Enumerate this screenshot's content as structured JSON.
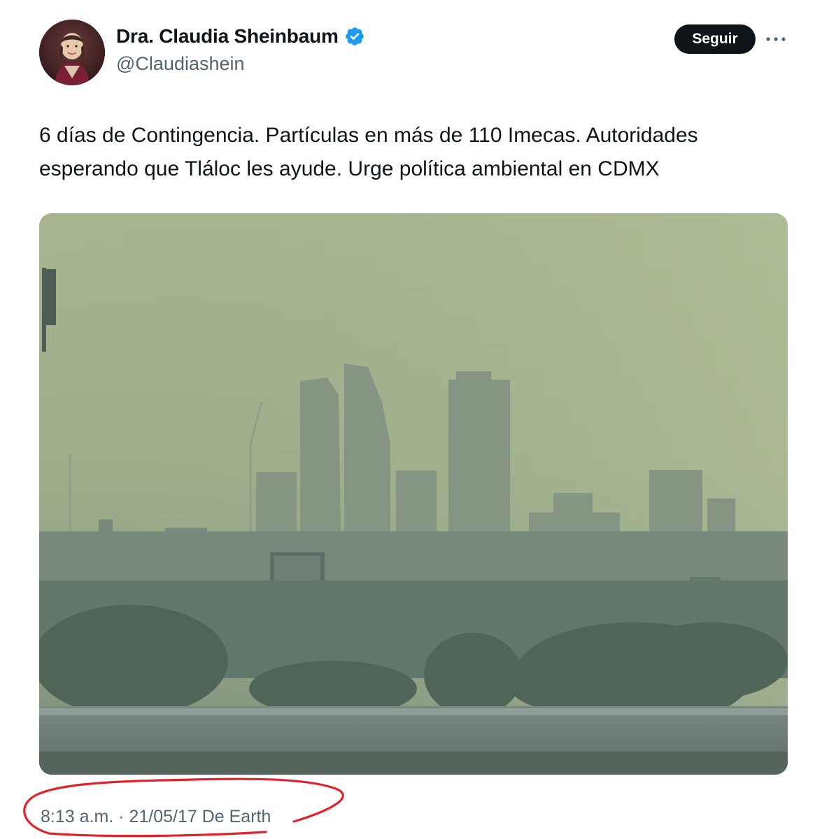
{
  "author": {
    "display_name": "Dra. Claudia Sheinbaum",
    "handle": "@Claudiashein",
    "verified": true,
    "avatar_icon": "profile-photo"
  },
  "actions": {
    "follow_label": "Seguir",
    "more_icon": "more-dots-icon"
  },
  "tweet": {
    "text": "6 días de Contingencia. Partículas en más de 110 Imecas. Autoridades esperando que Tláloc les ayude. Urge política ambiental en CDMX",
    "media": {
      "type": "photo",
      "subject": "hazy city skyline"
    }
  },
  "meta": {
    "time": "8:13 a.m.",
    "separator": " · ",
    "date": "21/05/17",
    "source": " De Earth"
  },
  "colors": {
    "text_primary": "#0f1419",
    "text_secondary": "#536471",
    "verified_blue": "#1d9bf0",
    "annotation_red": "#e0242f"
  }
}
